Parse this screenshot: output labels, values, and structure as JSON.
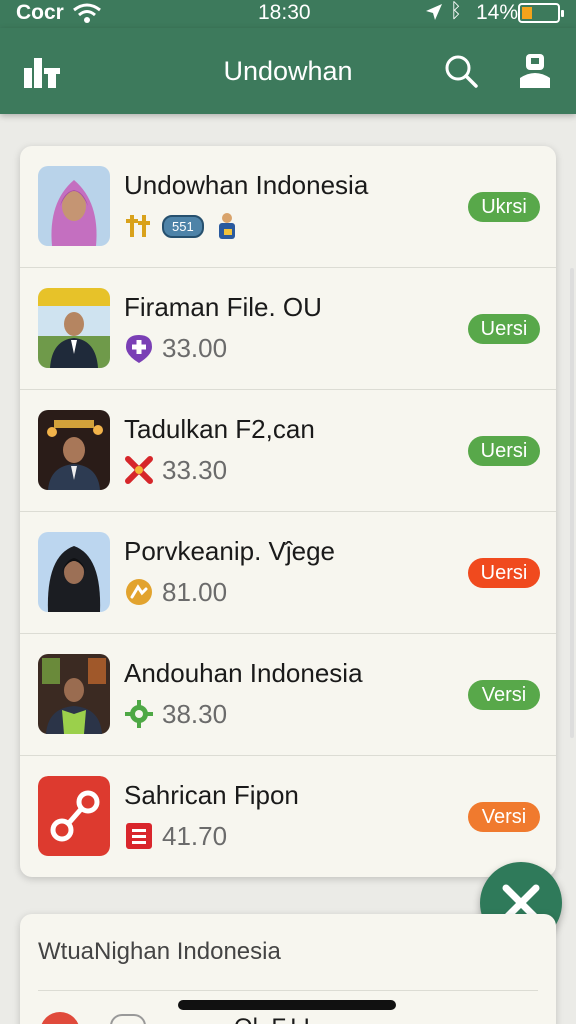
{
  "status_bar": {
    "carrier": "Cocr",
    "time": "18:30",
    "battery": "14%",
    "battery_level": 0.14
  },
  "app_bar": {
    "title": "Undowhan"
  },
  "list": [
    {
      "title": "Undowhan Indonesia",
      "value": "",
      "badge": "Ukrsi",
      "badge_color": "#58a84a",
      "meta_tag": "551",
      "meta_icon": "tools-icon"
    },
    {
      "title": "Firaman File. OU",
      "value": "33.00",
      "badge": "Uersi",
      "badge_color": "#58a84a",
      "meta_icon": "plus-pin-icon"
    },
    {
      "title": "Tadulkan F2,can",
      "value": "33.30",
      "badge": "Uersi",
      "badge_color": "#58a84a",
      "meta_icon": "cross-icon"
    },
    {
      "title": "Porvkeanip. Vĵege",
      "value": "81.00",
      "badge": "Uersi",
      "badge_color": "#f04a1e",
      "meta_icon": "coin-icon"
    },
    {
      "title": "Andouhan Indonesia",
      "value": "38.30",
      "badge": "Versi",
      "badge_color": "#58a84a",
      "meta_icon": "gear-icon"
    },
    {
      "title": "Sahrican Fipon",
      "value": "41.70",
      "badge": "Versi",
      "badge_color": "#f07a2e",
      "meta_icon": "document-icon"
    }
  ],
  "second_card": {
    "title": "WtuaNighan Indonesia",
    "partial": "Ol. F.I.I."
  }
}
